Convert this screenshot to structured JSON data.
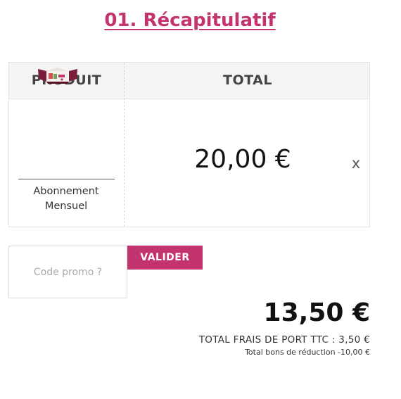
{
  "page": {
    "title": "01. Récapitulatif"
  },
  "cart": {
    "columns": {
      "product": "PRODUIT",
      "total": "TOTAL"
    },
    "item": {
      "image_icon": "subscription-box-image",
      "name_line1": "Abonnement",
      "name_line2": "Mensuel",
      "price": "20,00 €",
      "remove_label": "x"
    }
  },
  "promo": {
    "placeholder": "Code promo ?",
    "value": "",
    "submit_label": "VALIDER"
  },
  "summary": {
    "grand_total": "13,50 €",
    "shipping": "TOTAL FRAIS DE PORT TTC : 3,50 €",
    "discount": "Total bons de réduction -10,00 €"
  },
  "colors": {
    "accent": "#c3336e",
    "header_bg": "#f5f5f7",
    "border": "#e4e4e4"
  }
}
